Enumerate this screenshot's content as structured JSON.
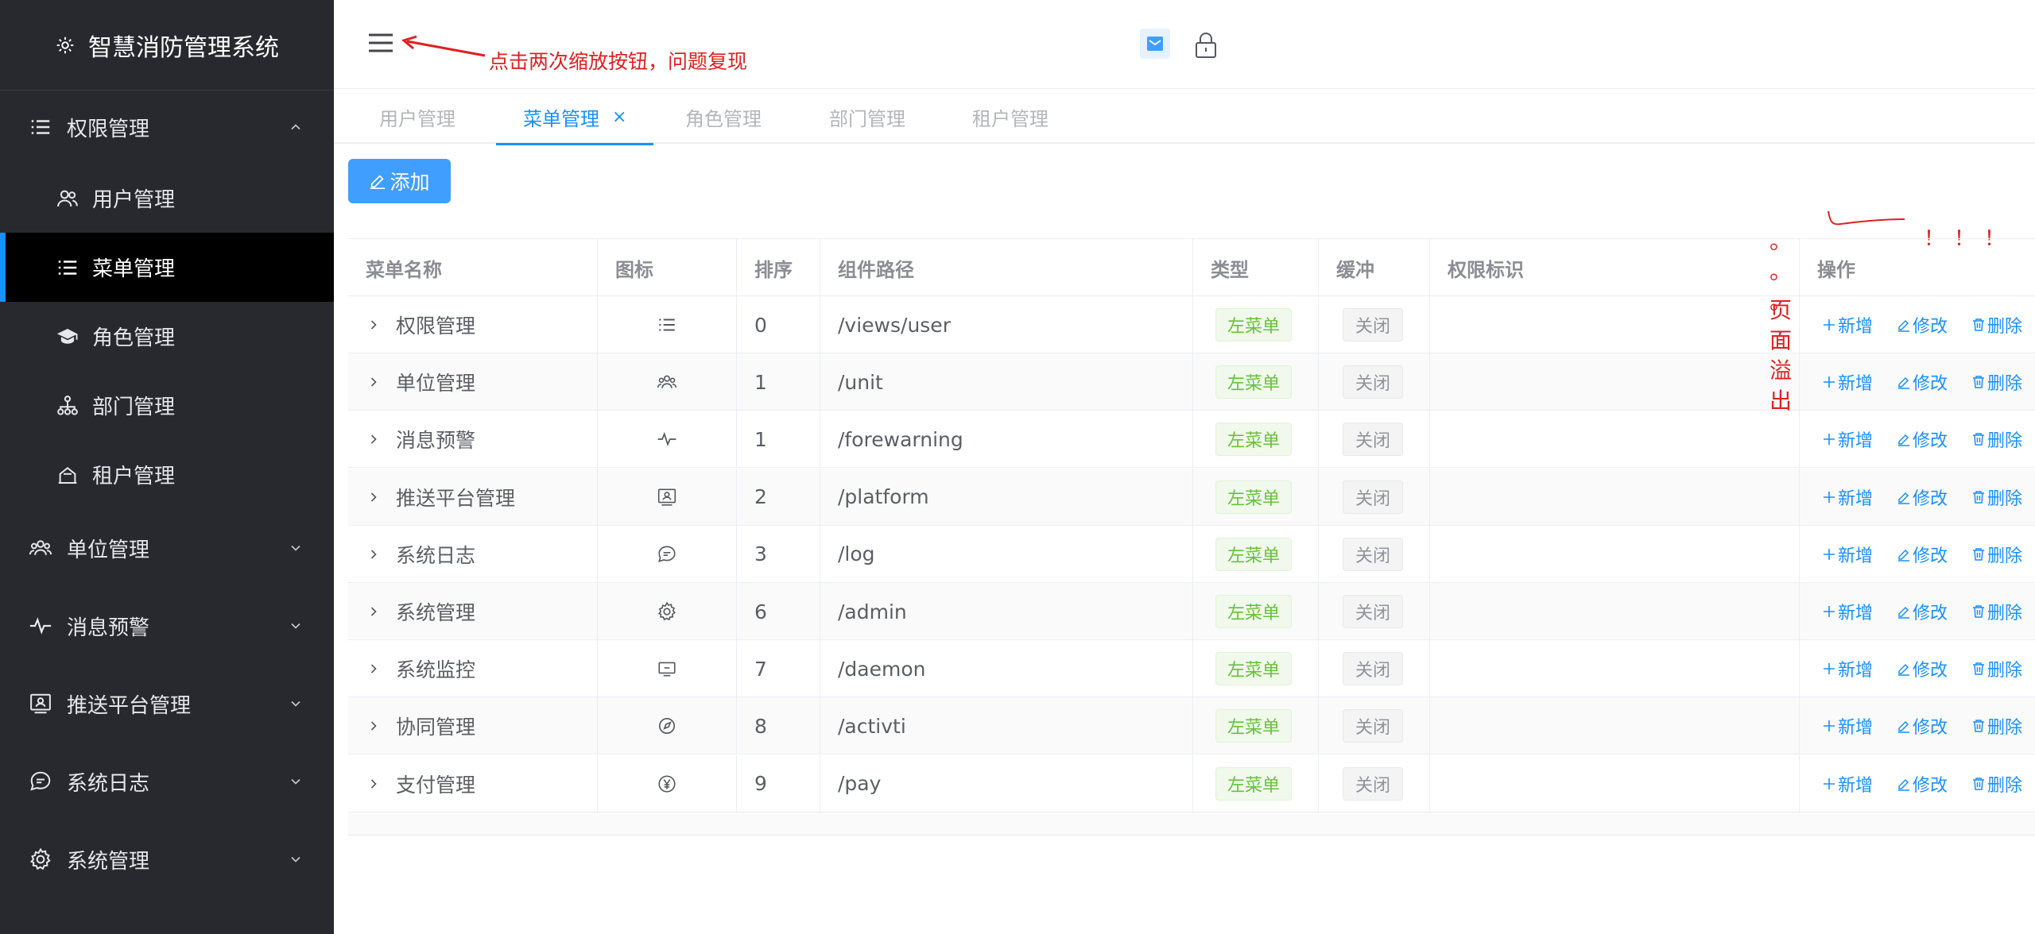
{
  "sidebar": {
    "title": "智慧消防管理系统",
    "groups": [
      {
        "label": "权限管理",
        "icon": "list-icon",
        "expanded": true,
        "children": [
          {
            "label": "用户管理",
            "icon": "users-icon"
          },
          {
            "label": "菜单管理",
            "icon": "menu-list-icon",
            "active": true
          },
          {
            "label": "角色管理",
            "icon": "graduation-cap-icon"
          },
          {
            "label": "部门管理",
            "icon": "org-chart-icon"
          },
          {
            "label": "租户管理",
            "icon": "tenant-icon"
          }
        ]
      },
      {
        "label": "单位管理",
        "icon": "group-icon"
      },
      {
        "label": "消息预警",
        "icon": "pulse-icon"
      },
      {
        "label": "推送平台管理",
        "icon": "monitor-user-icon"
      },
      {
        "label": "系统日志",
        "icon": "chat-icon"
      },
      {
        "label": "系统管理",
        "icon": "gear-icon"
      }
    ]
  },
  "annotations": {
    "top": "点击两次缩放按钮，问题复现",
    "dots": "。 。 。",
    "vertical": [
      "页",
      "面",
      "溢",
      "出"
    ],
    "exclaim": "！！！"
  },
  "tabs": [
    {
      "label": "用户管理"
    },
    {
      "label": "菜单管理",
      "active": true,
      "closable": true,
      "close": "×"
    },
    {
      "label": "角色管理"
    },
    {
      "label": "部门管理"
    },
    {
      "label": "租户管理"
    }
  ],
  "toolbar": {
    "add_label": "添加"
  },
  "table": {
    "headers": {
      "name": "菜单名称",
      "icon": "图标",
      "sort": "排序",
      "path": "组件路径",
      "type": "类型",
      "cache": "缓冲",
      "perm": "权限标识",
      "ops": "操作"
    },
    "ops_labels": {
      "add": "新增",
      "edit": "修改",
      "delete": "删除"
    },
    "rows": [
      {
        "name": "权限管理",
        "icon": "list-icon",
        "sort": "0",
        "path": "/views/user",
        "type": "左菜单",
        "cache": "关闭",
        "perm": ""
      },
      {
        "name": "单位管理",
        "icon": "group-icon",
        "sort": "1",
        "path": "/unit",
        "type": "左菜单",
        "cache": "关闭",
        "perm": ""
      },
      {
        "name": "消息预警",
        "icon": "pulse-icon",
        "sort": "1",
        "path": "/forewarning",
        "type": "左菜单",
        "cache": "关闭",
        "perm": ""
      },
      {
        "name": "推送平台管理",
        "icon": "monitor-user-icon",
        "sort": "2",
        "path": "/platform",
        "type": "左菜单",
        "cache": "关闭",
        "perm": ""
      },
      {
        "name": "系统日志",
        "icon": "chat-icon",
        "sort": "3",
        "path": "/log",
        "type": "左菜单",
        "cache": "关闭",
        "perm": ""
      },
      {
        "name": "系统管理",
        "icon": "gear-icon",
        "sort": "6",
        "path": "/admin",
        "type": "左菜单",
        "cache": "关闭",
        "perm": ""
      },
      {
        "name": "系统监控",
        "icon": "screen-icon",
        "sort": "7",
        "path": "/daemon",
        "type": "左菜单",
        "cache": "关闭",
        "perm": ""
      },
      {
        "name": "协同管理",
        "icon": "compass-icon",
        "sort": "8",
        "path": "/activti",
        "type": "左菜单",
        "cache": "关闭",
        "perm": ""
      },
      {
        "name": "支付管理",
        "icon": "yen-icon",
        "sort": "9",
        "path": "/pay",
        "type": "左菜单",
        "cache": "关闭",
        "perm": ""
      }
    ]
  },
  "colors": {
    "accent": "#1890ff",
    "sidebar_bg": "#28292f",
    "annotation": "#e02020",
    "tag_green": "#67c23a"
  }
}
